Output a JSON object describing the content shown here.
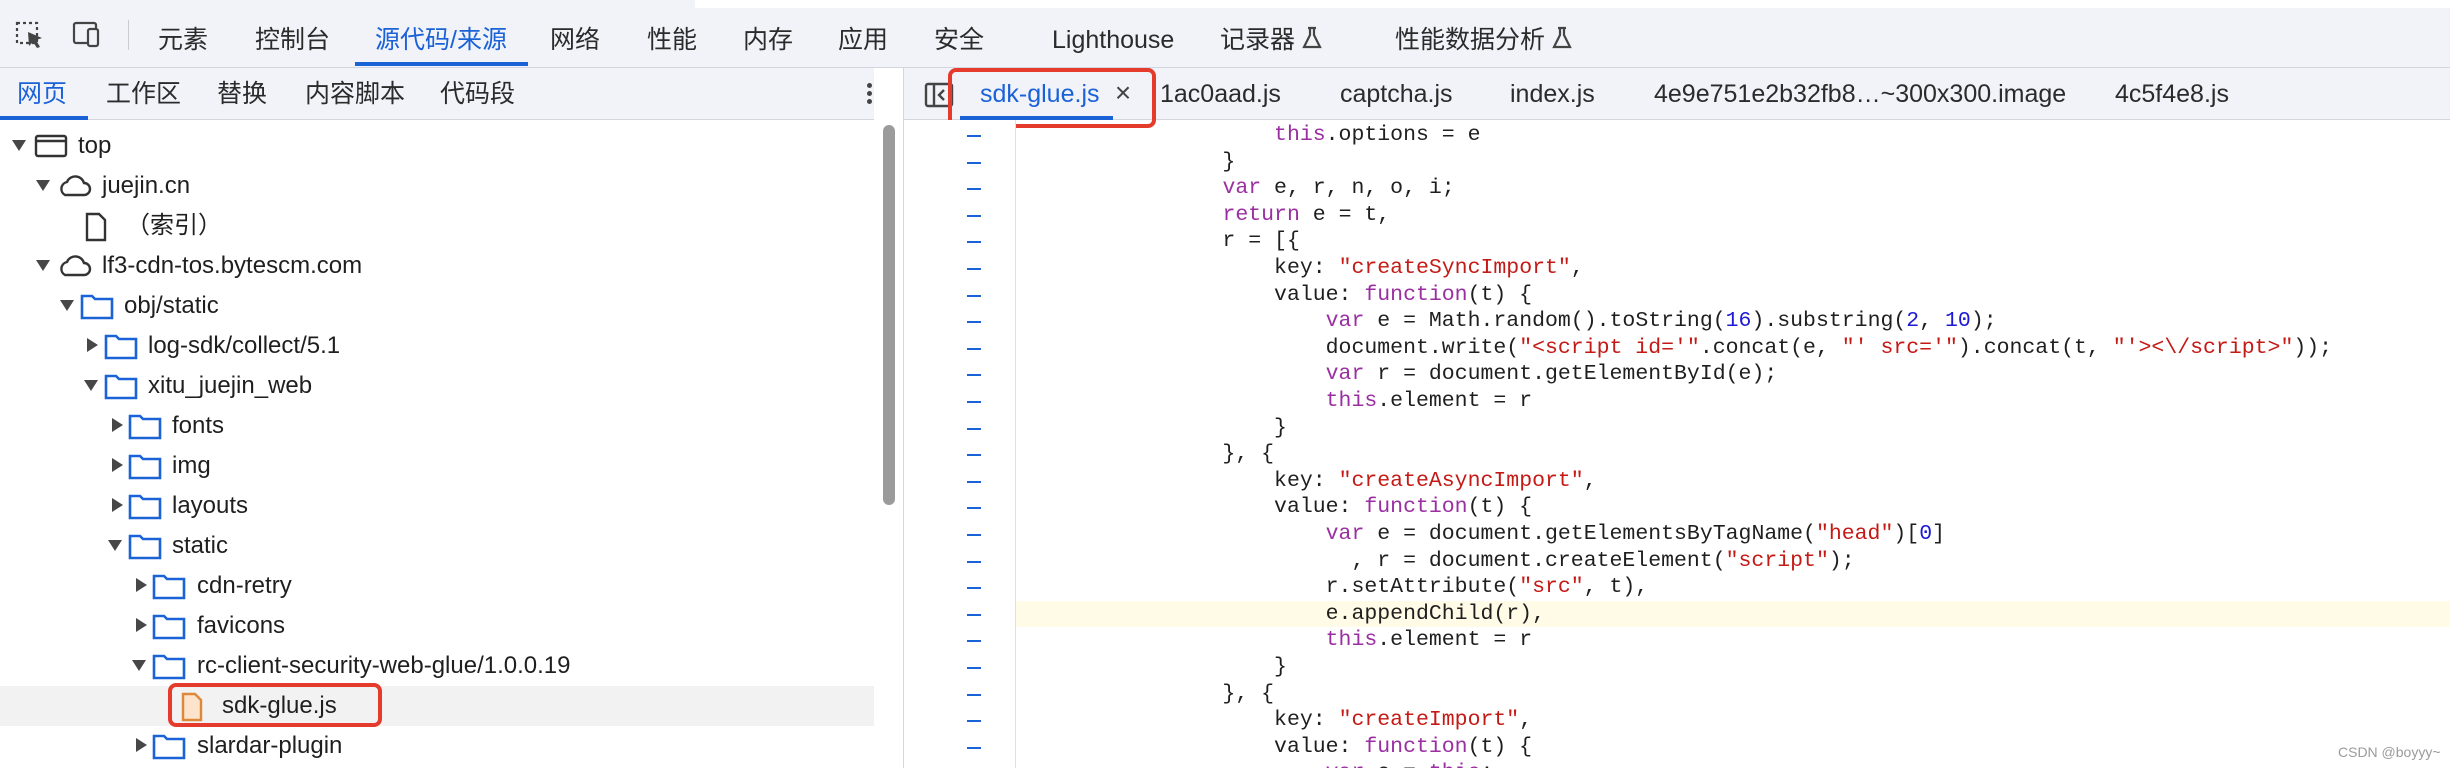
{
  "toolbar": {
    "icons": [
      "inspect-element-icon",
      "device-toolbar-icon"
    ],
    "panels": [
      {
        "label": "元素"
      },
      {
        "label": "控制台"
      },
      {
        "label": "源代码/来源"
      },
      {
        "label": "网络"
      },
      {
        "label": "性能"
      },
      {
        "label": "内存"
      },
      {
        "label": "应用"
      },
      {
        "label": "安全"
      },
      {
        "label": "Lighthouse"
      },
      {
        "label": "记录器"
      },
      {
        "label": "性能数据分析"
      }
    ],
    "active_panel": "源代码/来源"
  },
  "navigator": {
    "tabs": [
      {
        "label": "网页"
      },
      {
        "label": "工作区"
      },
      {
        "label": "替换"
      },
      {
        "label": "内容脚本"
      },
      {
        "label": "代码段"
      }
    ],
    "active_tab": "网页",
    "tree": [
      {
        "label": "top",
        "icon": "frame-icon",
        "expanded": true
      },
      {
        "label": "juejin.cn",
        "icon": "cloud-icon",
        "expanded": true
      },
      {
        "label": "（索引）",
        "icon": "file-icon"
      },
      {
        "label": "lf3-cdn-tos.bytescm.com",
        "icon": "cloud-icon",
        "expanded": true
      },
      {
        "label": "obj/static",
        "icon": "folder-icon",
        "expanded": true
      },
      {
        "label": "log-sdk/collect/5.1",
        "icon": "folder-icon",
        "expanded": false
      },
      {
        "label": "xitu_juejin_web",
        "icon": "folder-icon",
        "expanded": true
      },
      {
        "label": "fonts",
        "icon": "folder-icon",
        "expanded": false
      },
      {
        "label": "img",
        "icon": "folder-icon",
        "expanded": false
      },
      {
        "label": "layouts",
        "icon": "folder-icon",
        "expanded": false
      },
      {
        "label": "static",
        "icon": "folder-icon",
        "expanded": true
      },
      {
        "label": "cdn-retry",
        "icon": "folder-icon",
        "expanded": false
      },
      {
        "label": "favicons",
        "icon": "folder-icon",
        "expanded": false
      },
      {
        "label": "rc-client-security-web-glue/1.0.0.19",
        "icon": "folder-icon",
        "expanded": true
      },
      {
        "label": "sdk-glue.js",
        "icon": "js-file-icon",
        "selected": true
      },
      {
        "label": "slardar-plugin",
        "icon": "folder-icon",
        "expanded": false
      }
    ]
  },
  "editor": {
    "tabs": [
      {
        "label": "sdk-glue.js",
        "active": true,
        "closable": true
      },
      {
        "label": "1ac0aad.js"
      },
      {
        "label": "captcha.js"
      },
      {
        "label": "index.js"
      },
      {
        "label": "4e9e751e2b32fb8…~300x300.image"
      },
      {
        "label": "4c5f4e8.js"
      }
    ],
    "gutter_marker": "–",
    "code_lines": [
      "                    this.options = e",
      "                }",
      "                var e, r, n, o, i;",
      "                return e = t,",
      "                r = [{",
      "                    key: \"createSyncImport\",",
      "                    value: function(t) {",
      "                        var e = Math.random().toString(16).substring(2, 10);",
      "                        document.write(\"<script id='\".concat(e, \"' src='\").concat(t, \"'><\\/script>\"));",
      "                        var r = document.getElementById(e);",
      "                        this.element = r",
      "                    }",
      "                }, {",
      "                    key: \"createAsyncImport\",",
      "                    value: function(t) {",
      "                        var e = document.getElementsByTagName(\"head\")[0]",
      "                          , r = document.createElement(\"script\");",
      "                        r.setAttribute(\"src\", t),",
      "                        e.appendChild(r),",
      "                        this.element = r",
      "                    }",
      "                }, {",
      "                    key: \"createImport\",",
      "                    value: function(t) {",
      "                        var e = this;"
    ],
    "highlighted_line": 18
  },
  "watermark": "CSDN @boyyy~",
  "colors": {
    "accent": "#1a62d6",
    "highlight_box": "#e53b2c",
    "folder": "#1a62d6",
    "js_file": "#e0883a"
  }
}
